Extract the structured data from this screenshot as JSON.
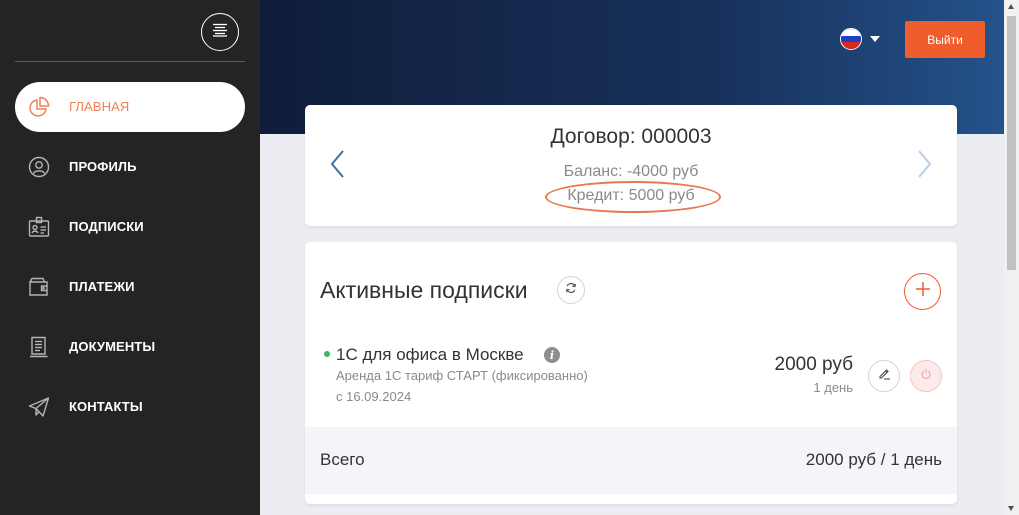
{
  "colors": {
    "sidebar_bg": "#252422",
    "accent": "#f05d2d",
    "active_text": "#ef8157",
    "header_gradient": [
      "#0f1d3a",
      "#24528a"
    ],
    "status_active": "#3cb371",
    "highlight_circle": "#e8794d"
  },
  "sidebar": {
    "toggle_icon": "hamburger-align-icon",
    "items": [
      {
        "label": "ГЛАВНАЯ",
        "icon": "pie-chart-icon",
        "active": true
      },
      {
        "label": "ПРОФИЛЬ",
        "icon": "user-circle-icon",
        "active": false
      },
      {
        "label": "ПОДПИСКИ",
        "icon": "id-badge-icon",
        "active": false
      },
      {
        "label": "ПЛАТЕЖИ",
        "icon": "wallet-icon",
        "active": false
      },
      {
        "label": "ДОКУМЕНТЫ",
        "icon": "document-icon",
        "active": false
      },
      {
        "label": "КОНТАКТЫ",
        "icon": "paper-plane-icon",
        "active": false
      }
    ]
  },
  "header": {
    "language_icon": "russia-flag-icon",
    "logout_label": "Выйти"
  },
  "contract": {
    "title": "Договор: 000003",
    "balance": "Баланс: -4000 руб",
    "credit": "Кредит: 5000 руб"
  },
  "subscriptions": {
    "title": "Активные подписки",
    "items": [
      {
        "name": "1С для офиса в Москве",
        "description": "Аренда 1С тариф СТАРТ (фиксированно)",
        "since": "с 16.09.2024",
        "price": "2000 руб",
        "period": "1 день",
        "status": "active"
      }
    ],
    "total_label": "Всего",
    "total_value": "2000 руб / 1 день"
  }
}
